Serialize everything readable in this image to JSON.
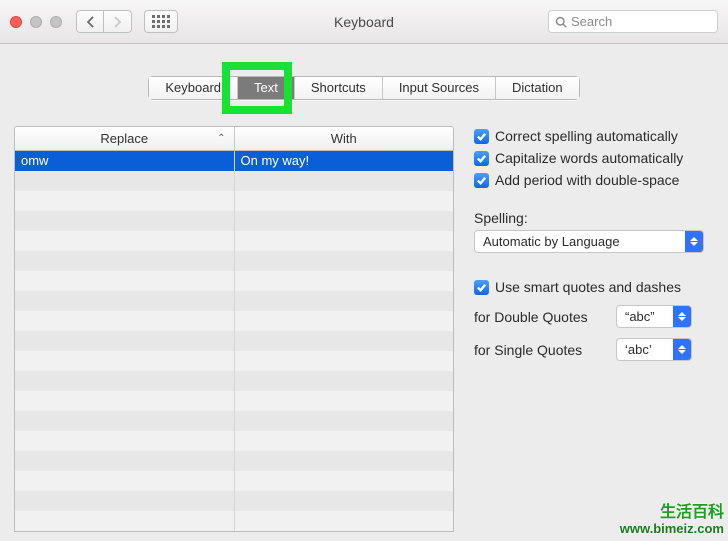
{
  "window": {
    "title": "Keyboard"
  },
  "search": {
    "placeholder": "Search"
  },
  "tabs": {
    "items": [
      "Keyboard",
      "Text",
      "Shortcuts",
      "Input Sources",
      "Dictation"
    ],
    "activeIndex": 1
  },
  "table": {
    "headers": {
      "replace": "Replace",
      "with": "With"
    },
    "rows": [
      {
        "replace": "omw",
        "with": "On my way!",
        "selected": true
      }
    ]
  },
  "options": {
    "correctSpelling": {
      "label": "Correct spelling automatically",
      "checked": true
    },
    "capitalize": {
      "label": "Capitalize words automatically",
      "checked": true
    },
    "addPeriod": {
      "label": "Add period with double-space",
      "checked": true
    },
    "spellingLabel": "Spelling:",
    "spellingValue": "Automatic by Language",
    "smartQuotes": {
      "label": "Use smart quotes and dashes",
      "checked": true
    },
    "doubleQuotesLabel": "for Double Quotes",
    "doubleQuotesValue": "“abc”",
    "singleQuotesLabel": "for Single Quotes",
    "singleQuotesValue": "‘abc’"
  },
  "watermark": {
    "line1": "生活百科",
    "line2": "www.bimeiz.com"
  }
}
